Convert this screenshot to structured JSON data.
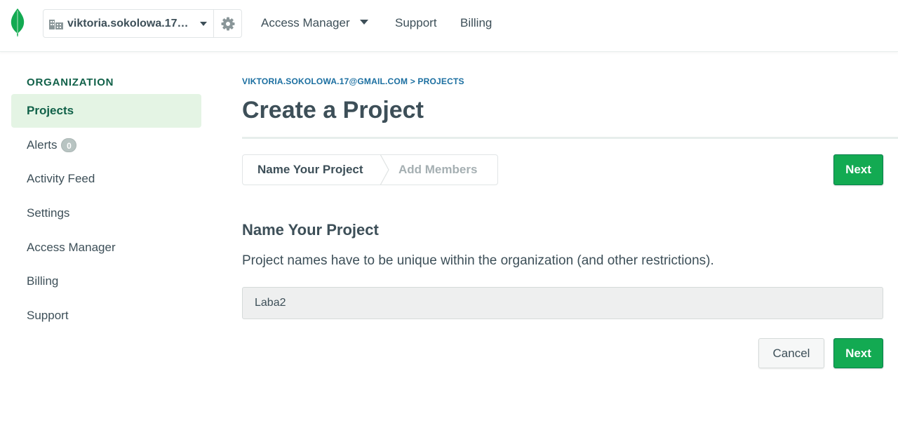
{
  "topbar": {
    "org_name": "viktoria.sokolowa.17…",
    "nav": {
      "access_manager": "Access Manager",
      "support": "Support",
      "billing": "Billing"
    }
  },
  "sidebar": {
    "heading": "ORGANIZATION",
    "items": [
      {
        "label": "Projects",
        "active": true
      },
      {
        "label": "Alerts",
        "badge": "0"
      },
      {
        "label": "Activity Feed"
      },
      {
        "label": "Settings"
      },
      {
        "label": "Access Manager"
      },
      {
        "label": "Billing"
      },
      {
        "label": "Support"
      }
    ]
  },
  "main": {
    "breadcrumb": "VIKTORIA.SOKOLOWA.17@GMAIL.COM > PROJECTS",
    "title": "Create a Project",
    "wizard": {
      "steps": [
        "Name Your Project",
        "Add Members"
      ],
      "active_step": 0
    },
    "next_top_label": "Next",
    "section_title": "Name Your Project",
    "section_desc": "Project names have to be unique within the organization (and other restrictions).",
    "project_name_value": "Laba2",
    "cancel_label": "Cancel",
    "next_bottom_label": "Next"
  },
  "colors": {
    "brand_green": "#13aa52",
    "link_blue": "#1a6ea0",
    "active_bg": "#e4f4e4",
    "text": "#3d4f58"
  },
  "icons": {
    "logo": "mongodb-leaf-icon",
    "org": "building-icon",
    "settings": "gear-icon",
    "dropdown": "caret-down-icon"
  }
}
